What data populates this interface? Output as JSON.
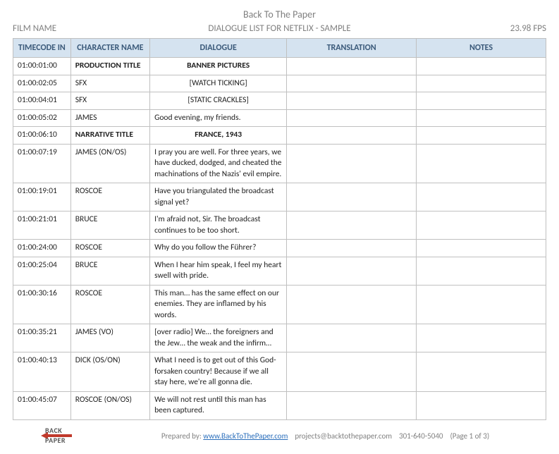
{
  "header": {
    "title": "Back To The Paper",
    "film_name_label": "FILM NAME",
    "subtitle": "DIALOGUE LIST FOR NETFLIX - SAMPLE",
    "fps": "23.98 FPS"
  },
  "columns": {
    "timecode": "TIMECODE IN",
    "character": "CHARACTER NAME",
    "dialogue": "DIALOGUE",
    "translation": "TRANSLATION",
    "notes": "NOTES"
  },
  "rows": [
    {
      "tc": "01:00:01:00",
      "ch": "PRODUCTION TITLE",
      "dlg": "BANNER PICTURES",
      "bold": true,
      "center": true
    },
    {
      "tc": "01:00:02:05",
      "ch": "SFX",
      "dlg": "[WATCH TICKING]",
      "center": true
    },
    {
      "tc": "01:00:04:01",
      "ch": "SFX",
      "dlg": "[STATIC CRACKLES]",
      "center": true
    },
    {
      "tc": "01:00:05:02",
      "ch": "JAMES",
      "dlg": "Good evening, my friends."
    },
    {
      "tc": "01:00:06:10",
      "ch": "NARRATIVE TITLE",
      "dlg": "FRANCE, 1943",
      "bold": true,
      "center": true
    },
    {
      "tc": "01:00:07:19",
      "ch": "JAMES (ON/OS)",
      "dlg": "I pray you are well. For three years, we have ducked, dodged, and cheated the machinations of the Nazis' evil empire."
    },
    {
      "tc": "01:00:19:01",
      "ch": "ROSCOE",
      "dlg": " Have you triangulated the broadcast signal yet?"
    },
    {
      "tc": "01:00:21:01",
      "ch": "BRUCE",
      "dlg": " I'm afraid not, Sir. The broadcast continues to be too short."
    },
    {
      "tc": "01:00:24:00",
      "ch": "ROSCOE",
      "dlg": " Why do you follow the Führer?"
    },
    {
      "tc": "01:00:25:04",
      "ch": "BRUCE",
      "dlg": " When I hear him speak, I feel my heart swell with pride."
    },
    {
      "tc": "01:00:30:16",
      "ch": "ROSCOE",
      "dlg": " This man… has the same effect on our enemies. They are inflamed by his words."
    },
    {
      "tc": "01:00:35:21",
      "ch": "JAMES (VO)",
      "dlg": " [over radio] We… the foreigners and the Jew… the weak and the infirm…"
    },
    {
      "tc": "01:00:40:13",
      "ch": "DICK (OS/ON)",
      "dlg": " What I need is to get out of this God-forsaken country! Because if we all stay here, we're all gonna die."
    },
    {
      "tc": "01:00:45:07",
      "ch": "ROSCOE (ON/OS)",
      "dlg": " We will not rest until this man has been captured."
    }
  ],
  "footer": {
    "prepared_by": "Prepared by: ",
    "url_text": "www.BackToThePaper.com",
    "email": "projects@backtothepaper.com",
    "phone": "301-640-5040",
    "page": "(Page 1 of 3)",
    "logo_back": "BACK",
    "logo_paper": "PAPER"
  }
}
